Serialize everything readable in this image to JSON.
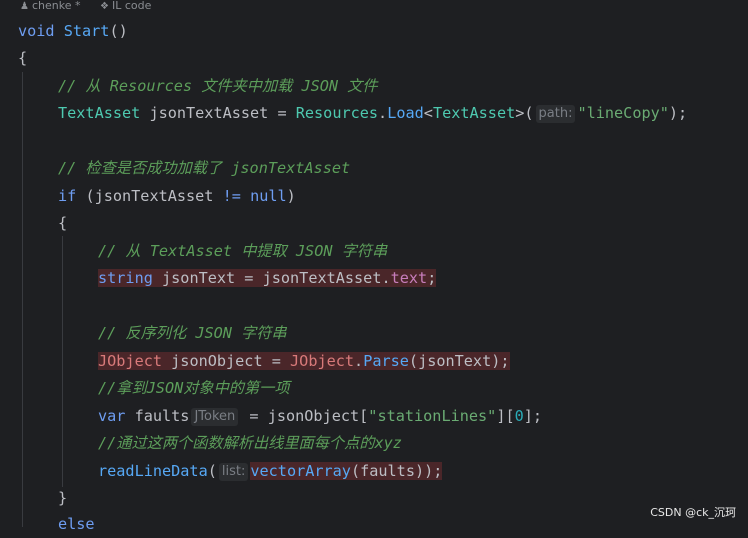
{
  "hints": {
    "author_glyph": "♟",
    "author": "chenke *",
    "il_glyph": "❖",
    "il_code": "IL code"
  },
  "code": {
    "l1_void": "void",
    "l1_name": "Start",
    "l1_parens": "()",
    "l2_brace": "{",
    "l3_comment": "// 从 Resources 文件夹中加载 JSON 文件",
    "l4_type": "TextAsset",
    "l4_var": " jsonTextAsset = ",
    "l4_class": "Resources",
    "l4_dot": ".",
    "l4_method": "Load",
    "l4_lt": "<",
    "l4_generic": "TextAsset",
    "l4_gt": ">(",
    "l4_hint": "path:",
    "l4_string": "\"lineCopy\"",
    "l4_end": ");",
    "l6_comment": "// 检查是否成功加载了 jsonTextAsset",
    "l7_if": "if",
    "l7_cond": " (jsonTextAsset ",
    "l7_op": "!=",
    "l7_space": " ",
    "l7_null": "null",
    "l7_close": ")",
    "l8_brace": "{",
    "l9_comment": "// 从 TextAsset 中提取 JSON 字符串",
    "l10_type": "string",
    "l10_rest": " jsonText = jsonTextAsset.",
    "l10_prop": "text",
    "l10_end": ";",
    "l12_comment": "// 反序列化 JSON 字符串",
    "l13_type": "JObject",
    "l13_var": " jsonObject = ",
    "l13_class": "JObject",
    "l13_dot": ".",
    "l13_method": "Parse",
    "l13_end": "(jsonText);",
    "l14_comment": "//拿到JSON对象中的第一项",
    "l15_var": "var",
    "l15_name": " faults",
    "l15_hint": "JToken",
    "l15_eq": " = jsonObject[",
    "l15_string": "\"stationLines\"",
    "l15_mid": "][",
    "l15_num": "0",
    "l15_end": "];",
    "l16_comment": "//通过这两个函数解析出线里面每个点的xyz",
    "l17_method": "readLineData",
    "l17_open": "(",
    "l17_hint": "list:",
    "l17_inner": "vectorArray",
    "l17_args": "(faults)",
    "l17_end": ");",
    "l18_brace": "}",
    "l19_else": "else"
  },
  "colors": {
    "background": "#1e1f22",
    "error_highlight": "#4a2629",
    "keyword": "#6e9df1",
    "string": "#6aab73",
    "comment": "#5c9e5a"
  },
  "watermark": "CSDN @ck_沉珂"
}
